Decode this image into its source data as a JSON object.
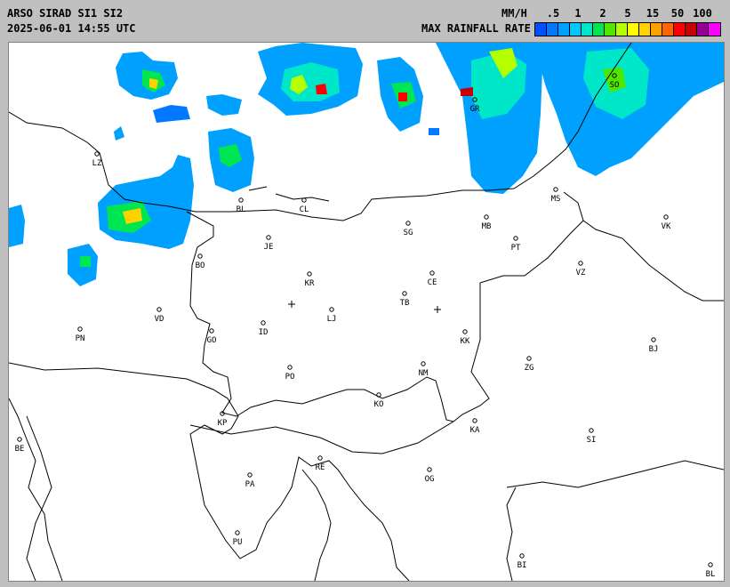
{
  "header": {
    "title": "ARSO SIRAD SI1 SI2",
    "datetime": "2025-06-01 14:55 UTC"
  },
  "legend": {
    "units": "MM/H",
    "title": "MAX RAINFALL RATE",
    "ticks": [
      ".5",
      "1",
      "2",
      "5",
      "15",
      "50",
      "100"
    ],
    "colors": [
      "#0050ff",
      "#0078ff",
      "#00a0ff",
      "#00c8ff",
      "#00e6c8",
      "#00e650",
      "#50e600",
      "#b4ff00",
      "#ffff00",
      "#ffd200",
      "#ffa000",
      "#ff6400",
      "#ff0000",
      "#c80000",
      "#960096",
      "#ff00ff"
    ]
  },
  "map": {
    "cities": [
      {
        "code": "LZ"
      },
      {
        "code": "SO"
      },
      {
        "code": "GR"
      },
      {
        "code": "BL"
      },
      {
        "code": "CL"
      },
      {
        "code": "MB"
      },
      {
        "code": "MS"
      },
      {
        "code": "VK"
      },
      {
        "code": "JE"
      },
      {
        "code": "SG"
      },
      {
        "code": "PT"
      },
      {
        "code": "BO"
      },
      {
        "code": "KR"
      },
      {
        "code": "CE"
      },
      {
        "code": "VZ"
      },
      {
        "code": "TB"
      },
      {
        "code": "VD"
      },
      {
        "code": "LJ"
      },
      {
        "code": "PN"
      },
      {
        "code": "GO"
      },
      {
        "code": "ID"
      },
      {
        "code": "KK"
      },
      {
        "code": "BJ"
      },
      {
        "code": "ZG"
      },
      {
        "code": "NM"
      },
      {
        "code": "PO"
      },
      {
        "code": "KO"
      },
      {
        "code": "KP"
      },
      {
        "code": "KA"
      },
      {
        "code": "SI"
      },
      {
        "code": "BE"
      },
      {
        "code": "RE"
      },
      {
        "code": "PA"
      },
      {
        "code": "OG"
      },
      {
        "code": "PU"
      },
      {
        "code": "BI"
      },
      {
        "code": "BL"
      }
    ],
    "radars": [
      {
        "name": "SI1"
      },
      {
        "name": "SI2"
      }
    ]
  }
}
